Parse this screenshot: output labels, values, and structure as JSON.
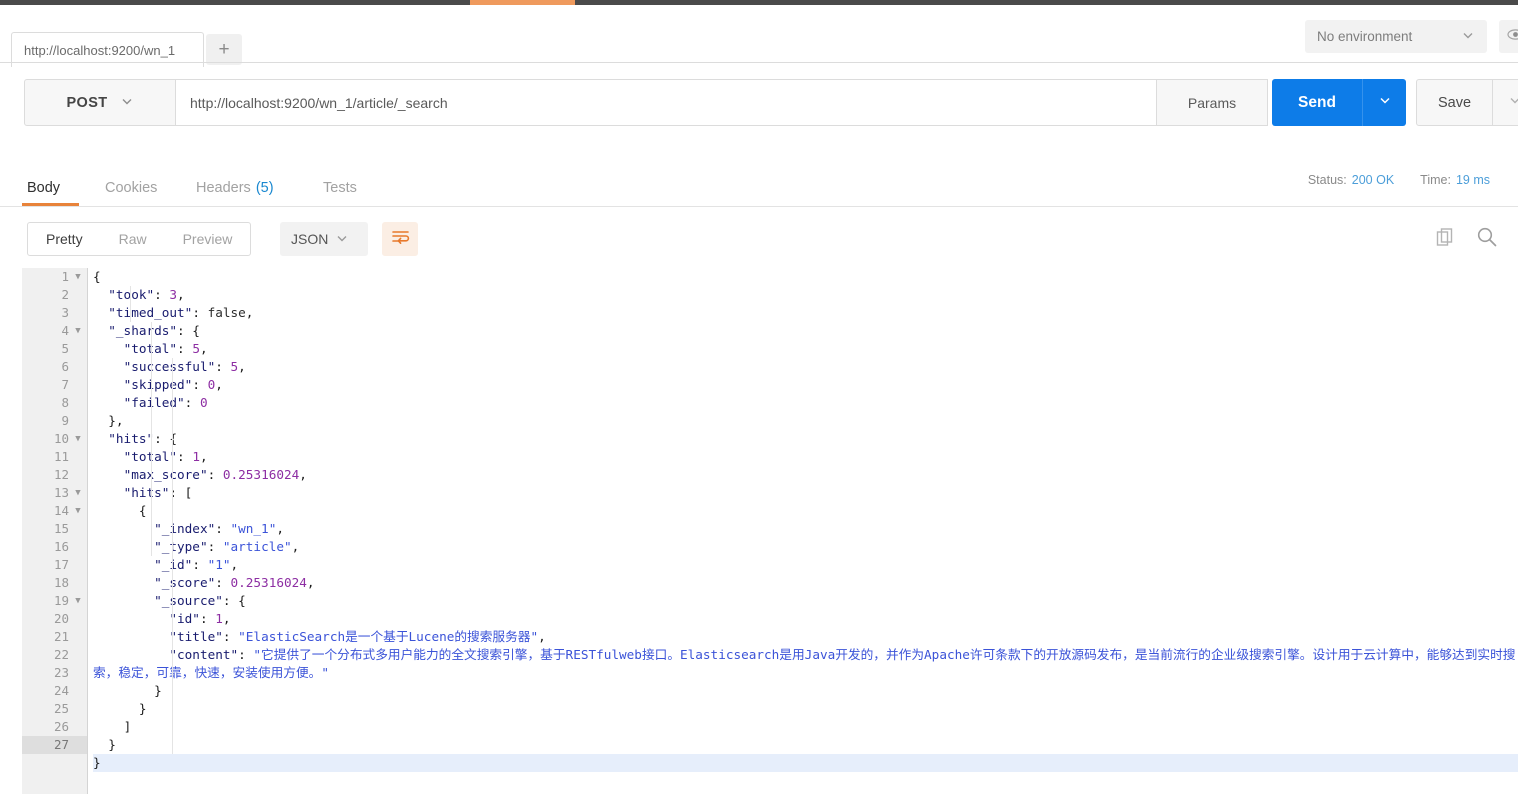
{
  "topbar": {
    "accent_color": "#ef9a5d",
    "bar_color": "#4a4a4a"
  },
  "tabbar": {
    "request_tab_label": "http://localhost:9200/wn_1",
    "new_tab_label": "+",
    "environment_label": "No environment",
    "environment_caret": "chevron-down-icon",
    "eye_icon": "eye-icon"
  },
  "request": {
    "method": "POST",
    "method_caret": "chevron-down-icon",
    "url": "http://localhost:9200/wn_1/article/_search",
    "params_label": "Params",
    "send_label": "Send",
    "send_caret": "chevron-down-icon",
    "save_label": "Save",
    "save_caret": "chevron-down-icon",
    "send_color": "#0d7ce8"
  },
  "response": {
    "tabs": [
      {
        "label": "Body",
        "active": true
      },
      {
        "label": "Cookies",
        "active": false
      },
      {
        "label": "Headers",
        "count": "(5)",
        "active": false
      },
      {
        "label": "Tests",
        "active": false
      }
    ],
    "status_label": "Status:",
    "status_value": "200 OK",
    "time_label": "Time:",
    "time_value": "19 ms",
    "accent_color": "#e8833a"
  },
  "body_toolbar": {
    "views": [
      {
        "label": "Pretty",
        "active": true
      },
      {
        "label": "Raw",
        "active": false
      },
      {
        "label": "Preview",
        "active": false
      }
    ],
    "format": "JSON",
    "format_caret": "chevron-down-icon",
    "wrap_icon": "word-wrap-icon",
    "copy_icon": "copy-icon",
    "search_icon": "search-icon"
  },
  "code": {
    "highlight_line": 27,
    "lines": [
      {
        "num": 1,
        "fold": true,
        "indent": 0,
        "tokens": [
          {
            "t": "p",
            "v": "{"
          }
        ]
      },
      {
        "num": 2,
        "fold": false,
        "indent": 1,
        "tokens": [
          {
            "t": "k",
            "v": "\"took\""
          },
          {
            "t": "p",
            "v": ": "
          },
          {
            "t": "n",
            "v": "3"
          },
          {
            "t": "p",
            "v": ","
          }
        ]
      },
      {
        "num": 3,
        "fold": false,
        "indent": 1,
        "tokens": [
          {
            "t": "k",
            "v": "\"timed_out\""
          },
          {
            "t": "p",
            "v": ": "
          },
          {
            "t": "b",
            "v": "false"
          },
          {
            "t": "p",
            "v": ","
          }
        ]
      },
      {
        "num": 4,
        "fold": true,
        "indent": 1,
        "tokens": [
          {
            "t": "k",
            "v": "\"_shards\""
          },
          {
            "t": "p",
            "v": ": {"
          }
        ]
      },
      {
        "num": 5,
        "fold": false,
        "indent": 2,
        "tokens": [
          {
            "t": "k",
            "v": "\"total\""
          },
          {
            "t": "p",
            "v": ": "
          },
          {
            "t": "n",
            "v": "5"
          },
          {
            "t": "p",
            "v": ","
          }
        ]
      },
      {
        "num": 6,
        "fold": false,
        "indent": 2,
        "tokens": [
          {
            "t": "k",
            "v": "\"successful\""
          },
          {
            "t": "p",
            "v": ": "
          },
          {
            "t": "n",
            "v": "5"
          },
          {
            "t": "p",
            "v": ","
          }
        ]
      },
      {
        "num": 7,
        "fold": false,
        "indent": 2,
        "tokens": [
          {
            "t": "k",
            "v": "\"skipped\""
          },
          {
            "t": "p",
            "v": ": "
          },
          {
            "t": "n",
            "v": "0"
          },
          {
            "t": "p",
            "v": ","
          }
        ]
      },
      {
        "num": 8,
        "fold": false,
        "indent": 2,
        "tokens": [
          {
            "t": "k",
            "v": "\"failed\""
          },
          {
            "t": "p",
            "v": ": "
          },
          {
            "t": "n",
            "v": "0"
          }
        ]
      },
      {
        "num": 9,
        "fold": false,
        "indent": 1,
        "tokens": [
          {
            "t": "p",
            "v": "},"
          }
        ]
      },
      {
        "num": 10,
        "fold": true,
        "indent": 1,
        "tokens": [
          {
            "t": "k",
            "v": "\"hits\""
          },
          {
            "t": "p",
            "v": ": {"
          }
        ]
      },
      {
        "num": 11,
        "fold": false,
        "indent": 2,
        "tokens": [
          {
            "t": "k",
            "v": "\"total\""
          },
          {
            "t": "p",
            "v": ": "
          },
          {
            "t": "n",
            "v": "1"
          },
          {
            "t": "p",
            "v": ","
          }
        ]
      },
      {
        "num": 12,
        "fold": false,
        "indent": 2,
        "tokens": [
          {
            "t": "k",
            "v": "\"max_score\""
          },
          {
            "t": "p",
            "v": ": "
          },
          {
            "t": "n",
            "v": "0.25316024"
          },
          {
            "t": "p",
            "v": ","
          }
        ]
      },
      {
        "num": 13,
        "fold": true,
        "indent": 2,
        "tokens": [
          {
            "t": "k",
            "v": "\"hits\""
          },
          {
            "t": "p",
            "v": ": ["
          }
        ]
      },
      {
        "num": 14,
        "fold": true,
        "indent": 3,
        "tokens": [
          {
            "t": "p",
            "v": "{"
          }
        ]
      },
      {
        "num": 15,
        "fold": false,
        "indent": 4,
        "tokens": [
          {
            "t": "k",
            "v": "\"_index\""
          },
          {
            "t": "p",
            "v": ": "
          },
          {
            "t": "s",
            "v": "\"wn_1\""
          },
          {
            "t": "p",
            "v": ","
          }
        ]
      },
      {
        "num": 16,
        "fold": false,
        "indent": 4,
        "tokens": [
          {
            "t": "k",
            "v": "\"_type\""
          },
          {
            "t": "p",
            "v": ": "
          },
          {
            "t": "s",
            "v": "\"article\""
          },
          {
            "t": "p",
            "v": ","
          }
        ]
      },
      {
        "num": 17,
        "fold": false,
        "indent": 4,
        "tokens": [
          {
            "t": "k",
            "v": "\"_id\""
          },
          {
            "t": "p",
            "v": ": "
          },
          {
            "t": "s",
            "v": "\"1\""
          },
          {
            "t": "p",
            "v": ","
          }
        ]
      },
      {
        "num": 18,
        "fold": false,
        "indent": 4,
        "tokens": [
          {
            "t": "k",
            "v": "\"_score\""
          },
          {
            "t": "p",
            "v": ": "
          },
          {
            "t": "n",
            "v": "0.25316024"
          },
          {
            "t": "p",
            "v": ","
          }
        ]
      },
      {
        "num": 19,
        "fold": true,
        "indent": 4,
        "tokens": [
          {
            "t": "k",
            "v": "\"_source\""
          },
          {
            "t": "p",
            "v": ": {"
          }
        ]
      },
      {
        "num": 20,
        "fold": false,
        "indent": 5,
        "tokens": [
          {
            "t": "k",
            "v": "\"id\""
          },
          {
            "t": "p",
            "v": ": "
          },
          {
            "t": "n",
            "v": "1"
          },
          {
            "t": "p",
            "v": ","
          }
        ]
      },
      {
        "num": 21,
        "fold": false,
        "indent": 5,
        "tokens": [
          {
            "t": "k",
            "v": "\"title\""
          },
          {
            "t": "p",
            "v": ": "
          },
          {
            "t": "s",
            "v": "\"ElasticSearch是一个基于Lucene的搜索服务器\""
          },
          {
            "t": "p",
            "v": ","
          }
        ]
      },
      {
        "num": 22,
        "fold": false,
        "indent": 5,
        "wrap": true,
        "tokens": [
          {
            "t": "k",
            "v": "\"content\""
          },
          {
            "t": "p",
            "v": ": "
          },
          {
            "t": "s",
            "v": "\"它提供了一个分布式多用户能力的全文搜索引擎，基于RESTfulweb接口。Elasticsearch是用Java开发的，并作为Apache许可条款下的开放源码发布，是当前流行的企业级搜索引擎。设计用于云计算中，能够达到实时搜索，稳定，可靠，快速，安装使用方便。\""
          }
        ]
      },
      {
        "num": 23,
        "fold": false,
        "indent": 4,
        "tokens": [
          {
            "t": "p",
            "v": "}"
          }
        ]
      },
      {
        "num": 24,
        "fold": false,
        "indent": 3,
        "tokens": [
          {
            "t": "p",
            "v": "}"
          }
        ]
      },
      {
        "num": 25,
        "fold": false,
        "indent": 2,
        "tokens": [
          {
            "t": "p",
            "v": "]"
          }
        ]
      },
      {
        "num": 26,
        "fold": false,
        "indent": 1,
        "tokens": [
          {
            "t": "p",
            "v": "}"
          }
        ]
      },
      {
        "num": 27,
        "fold": false,
        "indent": 0,
        "tokens": [
          {
            "t": "p",
            "v": "}"
          }
        ]
      }
    ]
  }
}
